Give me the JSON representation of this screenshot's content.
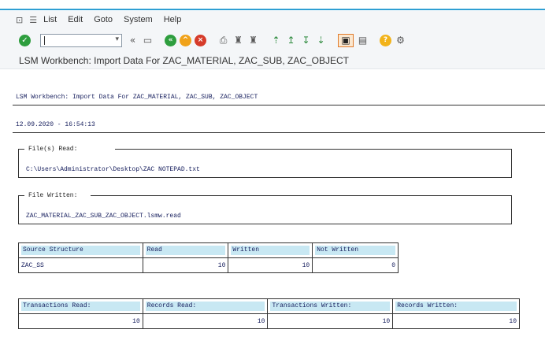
{
  "menubar": {
    "items": [
      "List",
      "Edit",
      "Goto",
      "System",
      "Help"
    ]
  },
  "toolbar": {
    "command_value": ""
  },
  "title": "LSM Workbench: Import Data For ZAC_MATERIAL, ZAC_SUB, ZAC_OBJECT",
  "report": {
    "header_line": "LSM Workbench: Import Data For ZAC_MATERIAL, ZAC_SUB, ZAC_OBJECT",
    "datetime": "12.09.2020 - 16:54:13",
    "files_read": {
      "label": "File(s) Read:",
      "value": "C:\\Users\\Administrator\\Desktop\\ZAC NOTEPAD.txt"
    },
    "file_written": {
      "label": "File Written:",
      "value": "ZAC_MATERIAL_ZAC_SUB_ZAC_OBJECT.lsmw.read"
    },
    "structure_table": {
      "headers": [
        "Source Structure",
        "Read",
        "Written",
        "Not Written"
      ],
      "row": [
        "ZAC_SS",
        "10",
        "10",
        "0"
      ]
    },
    "summary_table": {
      "headers": [
        "Transactions Read:",
        "Records Read:",
        "Transactions Written:",
        "Records Written:"
      ],
      "row": [
        "10",
        "10",
        "10",
        "10"
      ]
    }
  }
}
